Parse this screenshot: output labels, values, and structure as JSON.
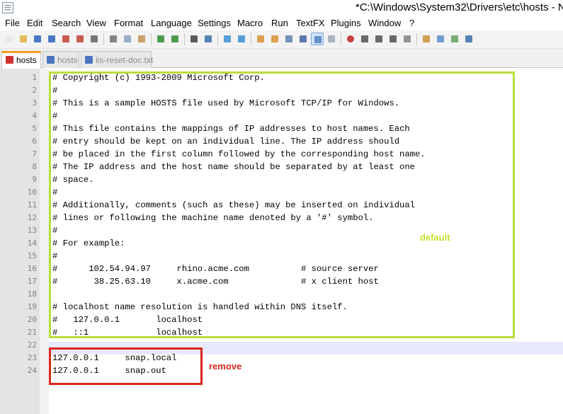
{
  "window": {
    "title": "*C:\\Windows\\System32\\Drivers\\etc\\hosts - N"
  },
  "menu": [
    "File",
    "Edit",
    "Search",
    "View",
    "Format",
    "Language",
    "Settings",
    "Macro",
    "Run",
    "TextFX",
    "Plugins",
    "Window",
    "?"
  ],
  "toolbar": {
    "icons": [
      {
        "name": "new-file-icon",
        "color": "#e6e6e6"
      },
      {
        "name": "open-file-icon",
        "color": "#e0b040"
      },
      {
        "name": "save-icon",
        "color": "#2a63b8"
      },
      {
        "name": "save-all-icon",
        "color": "#2a63b8"
      },
      {
        "name": "close-icon",
        "color": "#c04030"
      },
      {
        "name": "close-all-icon",
        "color": "#c04030"
      },
      {
        "name": "print-icon",
        "color": "#606060"
      },
      {
        "name": "cut-icon",
        "color": "#707070"
      },
      {
        "name": "copy-icon",
        "color": "#8aa0c0"
      },
      {
        "name": "paste-icon",
        "color": "#c09050"
      },
      {
        "name": "undo-icon",
        "color": "#2e8b2e"
      },
      {
        "name": "redo-icon",
        "color": "#2e8b2e"
      },
      {
        "name": "find-icon",
        "color": "#404040"
      },
      {
        "name": "replace-icon",
        "color": "#3a6ea8"
      },
      {
        "name": "zoom-in-icon",
        "color": "#3b8fd0"
      },
      {
        "name": "zoom-out-icon",
        "color": "#3b8fd0"
      },
      {
        "name": "sync-vertical-icon",
        "color": "#d89030"
      },
      {
        "name": "sync-horizontal-icon",
        "color": "#d89030"
      },
      {
        "name": "word-wrap-icon",
        "color": "#5a7fb0"
      },
      {
        "name": "show-all-characters-icon",
        "color": "#4060a0"
      },
      {
        "name": "indent-guide-icon",
        "color": "#5080c0"
      },
      {
        "name": "user-language-icon",
        "color": "#9aa8b8"
      },
      {
        "name": "record-macro-icon",
        "color": "#c02020"
      },
      {
        "name": "stop-recording-icon",
        "color": "#505050"
      },
      {
        "name": "play-macro-icon",
        "color": "#505050"
      },
      {
        "name": "run-macro-multiple-icon",
        "color": "#505050"
      },
      {
        "name": "save-macro-icon",
        "color": "#808080"
      },
      {
        "name": "function-list-icon",
        "color": "#c89030"
      },
      {
        "name": "document-map-icon",
        "color": "#5a8fc8"
      },
      {
        "name": "folder-as-workspace-icon",
        "color": "#60a060"
      },
      {
        "name": "spell-check-icon",
        "color": "#3a6ea8"
      }
    ]
  },
  "tabs": [
    {
      "label": "hosts",
      "active": true,
      "icon_color": "#d03030"
    },
    {
      "label": "hosts",
      "active": false,
      "icon_color": "#4a74c0"
    },
    {
      "label": "iis-reset-doc.txt",
      "active": false,
      "icon_color": "#4a74c0"
    }
  ],
  "editor": {
    "line_numbers": [
      "1",
      "2",
      "3",
      "4",
      "5",
      "6",
      "7",
      "8",
      "9",
      "10",
      "11",
      "12",
      "13",
      "14",
      "15",
      "16",
      "17",
      "18",
      "19",
      "20",
      "21",
      "22",
      "23",
      "24"
    ],
    "lines": [
      "# Copyright (c) 1993-2009 Microsoft Corp.",
      "#",
      "# This is a sample HOSTS file used by Microsoft TCP/IP for Windows.",
      "#",
      "# This file contains the mappings of IP addresses to host names. Each",
      "# entry should be kept on an individual line. The IP address should",
      "# be placed in the first column followed by the corresponding host name.",
      "# The IP address and the host name should be separated by at least one",
      "# space.",
      "#",
      "# Additionally, comments (such as these) may be inserted on individual",
      "# lines or following the machine name denoted by a '#' symbol.",
      "#",
      "# For example:",
      "#",
      "#      102.54.94.97     rhino.acme.com          # source server",
      "#       38.25.63.10     x.acme.com              # x client host",
      "",
      "# localhost name resolution is handled within DNS itself.",
      "#   127.0.0.1       localhost",
      "#   ::1             localhost",
      "",
      "127.0.0.1     snap.local",
      "127.0.0.1     snap.out"
    ]
  },
  "annotations": {
    "default_label": "default",
    "remove_label": "remove",
    "default_color": "#b9dc3c",
    "remove_color": "#d9261c"
  }
}
